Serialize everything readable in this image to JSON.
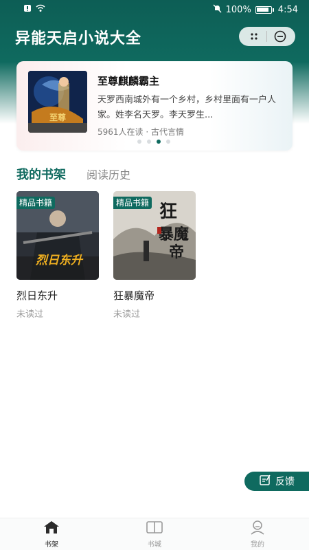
{
  "status_bar": {
    "battery": "100%",
    "time": "4:54"
  },
  "header": {
    "title": "异能天启小说大全"
  },
  "banner": {
    "title": "至尊麒麟霸主",
    "description": "天罗西南城外有一个乡村，乡村里面有一户人家。姓李名天罗。李天罗生...",
    "meta": "5961人在读 · 古代言情",
    "dots": 4,
    "active_dot": 2
  },
  "tabs": {
    "shelf": "我的书架",
    "history": "阅读历史"
  },
  "books": [
    {
      "badge": "精品书籍",
      "title": "烈日东升",
      "status": "未读过"
    },
    {
      "badge": "精品书籍",
      "title": "狂暴魔帝",
      "status": "未读过"
    }
  ],
  "feedback": {
    "label": "反馈"
  },
  "nav": {
    "items": [
      {
        "label": "书架"
      },
      {
        "label": "书城"
      },
      {
        "label": "我的"
      }
    ]
  },
  "colors": {
    "brand": "#0f6a5f"
  }
}
